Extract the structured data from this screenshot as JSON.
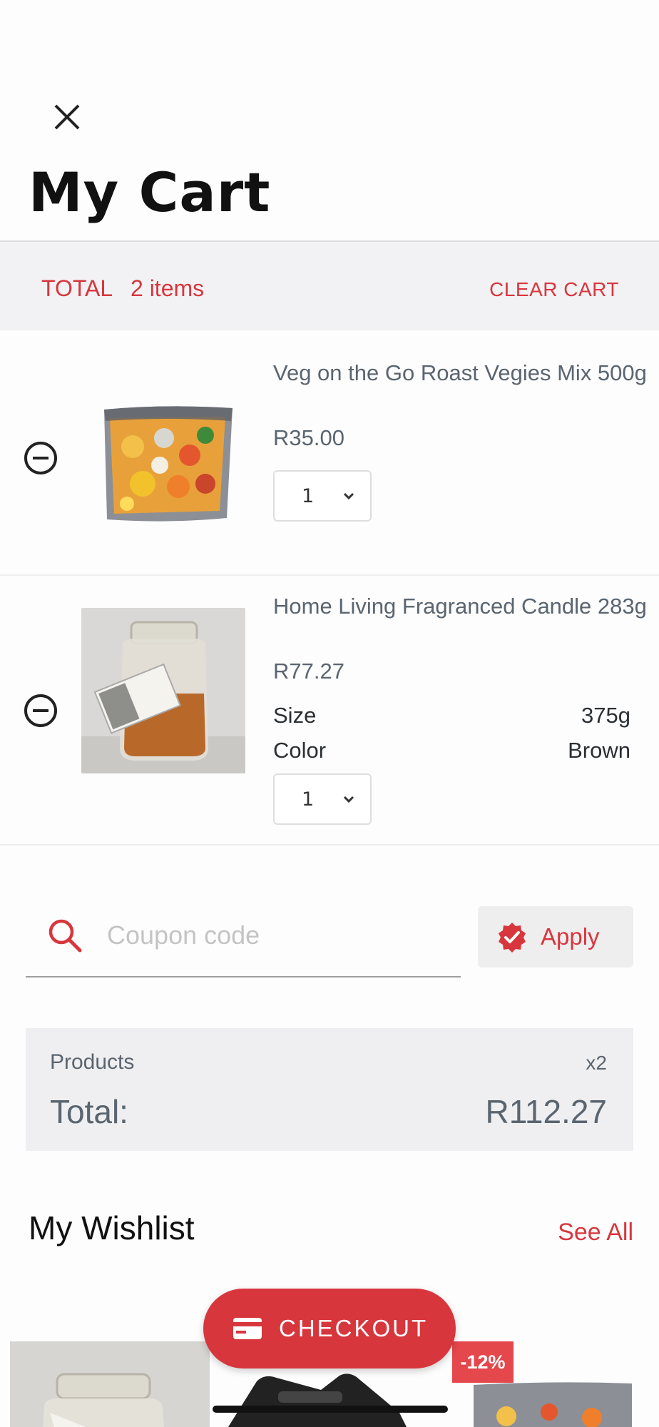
{
  "header": {
    "close_icon": "close-icon",
    "title": "My Cart"
  },
  "total_bar": {
    "label": "TOTAL",
    "count": "2 items",
    "clear_label": "CLEAR CART"
  },
  "cart": {
    "items": [
      {
        "name": "Veg on the Go Roast Vegies Mix 500g",
        "price": "R35.00",
        "quantity": "1",
        "attributes": []
      },
      {
        "name": "Home Living Fragranced Candle 283g",
        "price": "R77.27",
        "quantity": "1",
        "attributes": [
          {
            "label": "Size",
            "value": "375g"
          },
          {
            "label": "Color",
            "value": "Brown"
          }
        ]
      }
    ]
  },
  "coupon": {
    "placeholder": "Coupon code",
    "value": "",
    "apply_label": "Apply"
  },
  "summary": {
    "products_label": "Products",
    "products_count": "x2",
    "total_label": "Total:",
    "total_value": "R112.27"
  },
  "wishlist": {
    "title": "My Wishlist",
    "see_all": "See All",
    "discount_badge": "-12%"
  },
  "checkout": {
    "label": "CHECKOUT",
    "icon": "credit-card-icon"
  },
  "colors": {
    "accent": "#d8363d",
    "badge": "#e4474c",
    "panel": "#f2f2f4",
    "muted_text": "#5a6570"
  }
}
